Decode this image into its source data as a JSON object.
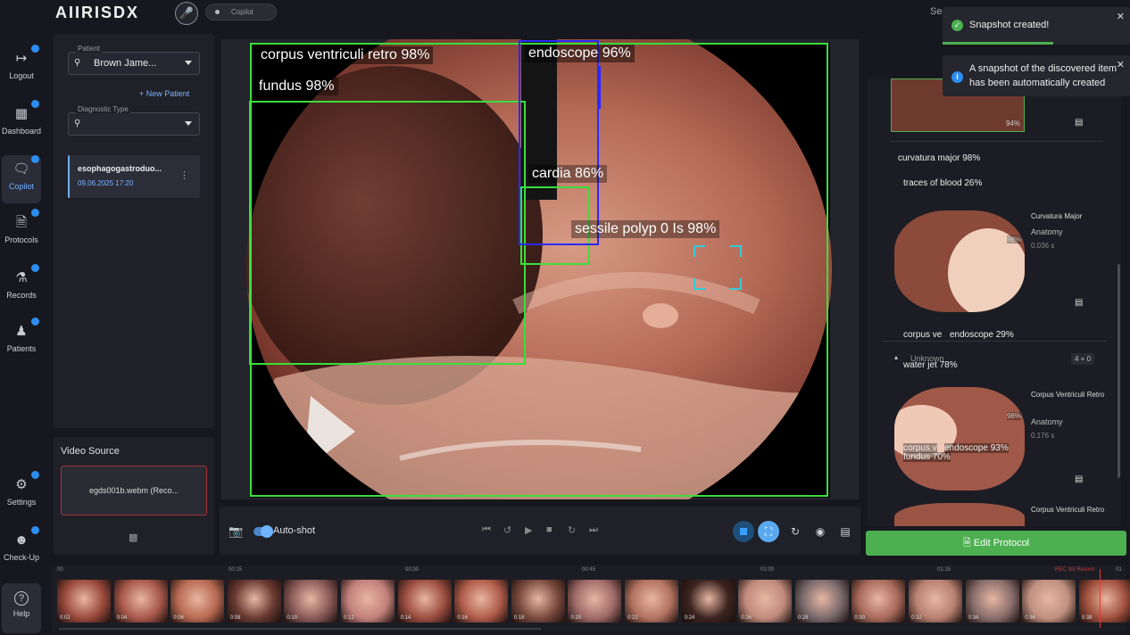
{
  "app": {
    "logo": "AIIRISDX"
  },
  "header": {
    "copilot_label": "Copilot",
    "search_label": "Se"
  },
  "sidebar": {
    "items": [
      {
        "label": "Logout",
        "icon": "logout-icon"
      },
      {
        "label": "Dashboard",
        "icon": "dashboard-icon"
      },
      {
        "label": "Copilot",
        "icon": "chat-icon"
      },
      {
        "label": "Protocols",
        "icon": "document-icon"
      },
      {
        "label": "Records",
        "icon": "microscope-icon"
      },
      {
        "label": "Patients",
        "icon": "people-icon"
      },
      {
        "label": "Settings",
        "icon": "gear-icon"
      },
      {
        "label": "Check-Up",
        "icon": "person-icon"
      },
      {
        "label": "Help",
        "icon": "help-icon"
      }
    ]
  },
  "patient_panel": {
    "patient_label": "Patient",
    "patient_value": "Brown Jame...",
    "new_patient": "+ New Patient",
    "diag_label": "Diagnostic Type",
    "diag_value": "",
    "study": {
      "title": "esophagogastroduo...",
      "date": "09.06.2025 17:20"
    }
  },
  "video_source": {
    "title": "Video Source",
    "file": "egds001b.webm (Reco..."
  },
  "detections": [
    {
      "label": "corpus ventriculi retro 98%"
    },
    {
      "label": "endoscope 96%"
    },
    {
      "label": "fundus 98%"
    },
    {
      "label": "cardia 86%"
    },
    {
      "label": "sessile polyp 0 Is 98%"
    }
  ],
  "controls": {
    "autoshot_label": "Auto-shot",
    "autoshot_on": true
  },
  "right_panel": {
    "cards": [
      {
        "tags": [
          "curvatura major 98%",
          "traces of blood 26%"
        ],
        "title": "Curvatura Major",
        "category": "Anatomy",
        "time": "0.036 s",
        "overlay": "98%"
      },
      {
        "tags": [
          "corpus ve",
          "endoscope 29%",
          "water jet 78%"
        ],
        "group": "Unknown",
        "count": "4 + 0"
      },
      {
        "tags": [
          "corpus v",
          "endoscope 93%",
          "fundus 70%"
        ],
        "title": "Corpus Ventriculi Retro",
        "category": "Anatomy",
        "time": "0.176 s",
        "overlay": "98%"
      },
      {
        "title": "Corpus Ventriculi Retro"
      }
    ],
    "top_overlay": "94%"
  },
  "edit_protocol": {
    "label": "Edit Protocol"
  },
  "toasts": [
    {
      "type": "success",
      "text": "Snapshot created!"
    },
    {
      "type": "info",
      "text": "A snapshot of the discovered item has been automatically created"
    }
  ],
  "timeline": {
    "ticks": [
      "00",
      "00:15",
      "00:30",
      "00:45",
      "01:00",
      "01:15",
      "01"
    ],
    "thumbs": [
      "0:02",
      "0:04",
      "0:06",
      "0:08",
      "0:10",
      "0:12",
      "0:14",
      "0:16",
      "0:18",
      "0:20",
      "0:22",
      "0:24",
      "0:26",
      "0:28",
      "0:30",
      "0:32",
      "0:34",
      "0:36",
      "0:38"
    ],
    "rec_label": "REC 3/8 Record"
  },
  "colors": {
    "accent": "#2c8ef0",
    "success": "#4caf50",
    "detect_green": "#3adf3a",
    "detect_blue": "#2a2aff",
    "detect_cyan": "#38c9d6"
  }
}
